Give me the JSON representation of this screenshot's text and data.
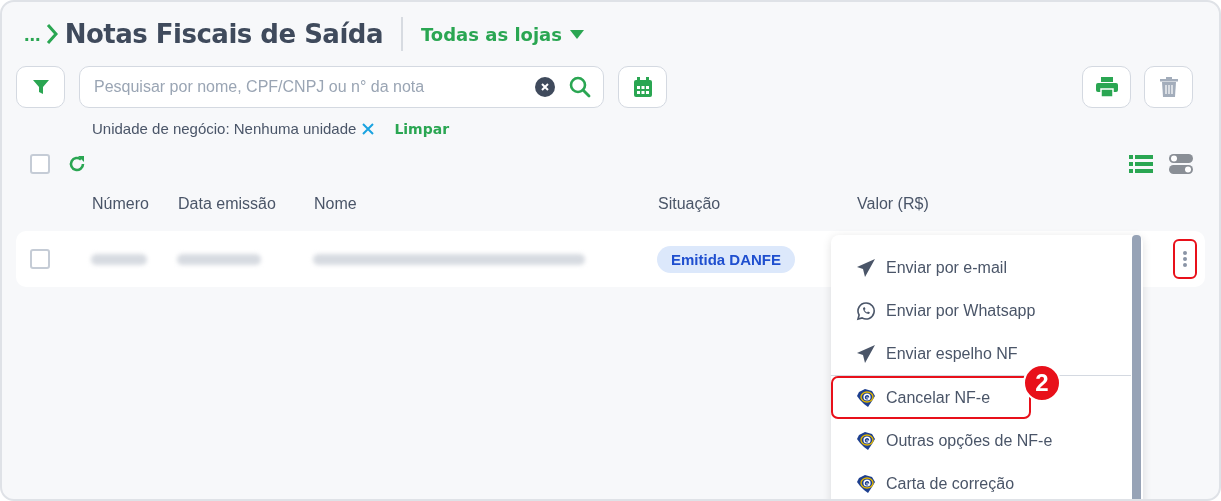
{
  "breadcrumb": {
    "ellipsis": "...",
    "title": "Notas Fiscais de Saída"
  },
  "store_selector": {
    "label": "Todas as lojas"
  },
  "search": {
    "placeholder": "Pesquisar por nome, CPF/CNPJ ou n° da nota"
  },
  "filter_chip": {
    "label": "Unidade de negócio: Nenhuma unidade",
    "clear": "Limpar"
  },
  "select_all": {
    "checked": false
  },
  "table": {
    "columns": [
      "Número",
      "Data emissão",
      "Nome",
      "Situação",
      "Valor (R$)"
    ],
    "rows": [
      {
        "checked": false,
        "status": "Emitida DANFE",
        "menu_highlighted": true
      }
    ]
  },
  "menu": {
    "items": [
      {
        "kind": "send",
        "label": "Enviar por e-mail",
        "highlighted": false,
        "divider_after": false
      },
      {
        "kind": "whatsapp",
        "label": "Enviar por Whatsapp",
        "highlighted": false,
        "divider_after": false
      },
      {
        "kind": "send",
        "label": "Enviar espelho NF",
        "highlighted": false,
        "divider_after": true
      },
      {
        "kind": "nfe",
        "label": "Cancelar NF-e",
        "highlighted": true,
        "divider_after": false
      },
      {
        "kind": "nfe",
        "label": "Outras opções de NF-e",
        "highlighted": false,
        "divider_after": false
      },
      {
        "kind": "nfe",
        "label": "Carta de correção",
        "highlighted": false,
        "divider_after": false
      }
    ]
  },
  "step_badge": "2"
}
